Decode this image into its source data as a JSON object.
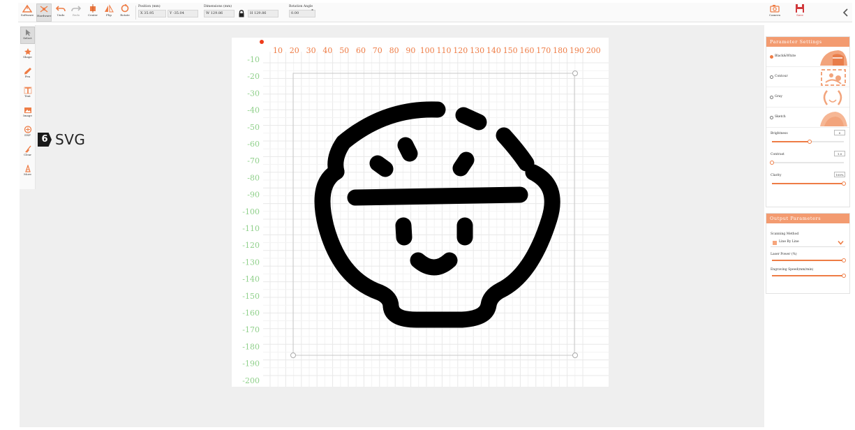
{
  "toolbar": {
    "left_buttons": [
      {
        "label": "Software",
        "icon": "laser-logo-icon",
        "active": false
      },
      {
        "label": "Hardware",
        "icon": "hardware-icon",
        "active": true
      },
      {
        "label": "Undo",
        "icon": "undo-icon",
        "active": false
      },
      {
        "label": "Redo",
        "icon": "redo-icon",
        "active": false
      },
      {
        "label": "Center",
        "icon": "center-icon",
        "active": false
      },
      {
        "label": "Flip",
        "icon": "flip-icon",
        "active": false
      },
      {
        "label": "Rotate",
        "icon": "rotate-icon",
        "active": false
      }
    ],
    "position": {
      "label": "Position (mm)",
      "x": "X 35.95",
      "y": "Y -35.04"
    },
    "dimensions": {
      "label": "Dimensions (mm)",
      "w": "W 129.86",
      "h": "H 129.86",
      "lock_icon": "lock-icon"
    },
    "rotation": {
      "label": "Rotation Angle",
      "value": "0.00",
      "unit": "°"
    },
    "right_buttons": [
      {
        "label": "Camera",
        "icon": "camera-icon"
      },
      {
        "label": "Save",
        "icon": "save-icon"
      }
    ],
    "collapse_icon": "chevron-left-icon"
  },
  "left_tools": [
    {
      "label": "Select",
      "icon": "cursor-icon",
      "active": true
    },
    {
      "label": "Shape",
      "icon": "shape-icon",
      "active": false
    },
    {
      "label": "Pen",
      "icon": "pen-icon",
      "active": false
    },
    {
      "label": "Text",
      "icon": "text-icon",
      "active": false
    },
    {
      "label": "Image",
      "icon": "image-icon",
      "active": false
    },
    {
      "label": "DXF",
      "icon": "dxf-icon",
      "active": false
    },
    {
      "label": "Clear",
      "icon": "broom-icon",
      "active": false
    },
    {
      "label": "More",
      "icon": "more-icon",
      "active": false
    }
  ],
  "badge": {
    "number": "6",
    "text": "SVG"
  },
  "canvas": {
    "x_ticks": [
      10,
      20,
      30,
      40,
      50,
      60,
      70,
      80,
      90,
      100,
      110,
      120,
      130,
      140,
      150,
      160,
      170,
      180,
      190,
      200
    ],
    "y_ticks": [
      -10,
      -20,
      -30,
      -40,
      -50,
      -60,
      -70,
      -80,
      -90,
      -100,
      -110,
      -120,
      -130,
      -140,
      -150,
      -160,
      -170,
      -180,
      -190,
      -200
    ],
    "x_tick_color": "#ee7c45",
    "y_tick_color": "#8fd08a",
    "artwork": "rice-bowl-smiley"
  },
  "parameter_settings": {
    "title": "Parameter Settings",
    "modes": [
      {
        "label": "Black&White",
        "selected": true,
        "thumb": "bw-thumb"
      },
      {
        "label": "Contour",
        "selected": false,
        "thumb": "contour-thumb"
      },
      {
        "label": "Gray",
        "selected": false,
        "thumb": "gray-thumb"
      },
      {
        "label": "Sketch",
        "selected": false,
        "thumb": "sketch-thumb"
      }
    ],
    "sliders": [
      {
        "label": "Brightness",
        "value": "0",
        "fraction": 0.52
      },
      {
        "label": "Contrast",
        "value": "1.0",
        "fraction": 0.0
      },
      {
        "label": "Clarity",
        "value": "100%",
        "fraction": 1.0
      }
    ]
  },
  "output_parameters": {
    "title": "Output Parameters",
    "scanning_label": "Scanning Method",
    "scanning_value": "Line By Line",
    "laser_power_label": "Laser Power (%)",
    "laser_power": 1.0,
    "speed_label": "Engraving Speed(mm/min)",
    "speed": 1.0
  },
  "colors": {
    "accent": "#ee7c45",
    "accent_light": "#f39b70",
    "workspace": "#efefef",
    "artwork": "#000000"
  }
}
